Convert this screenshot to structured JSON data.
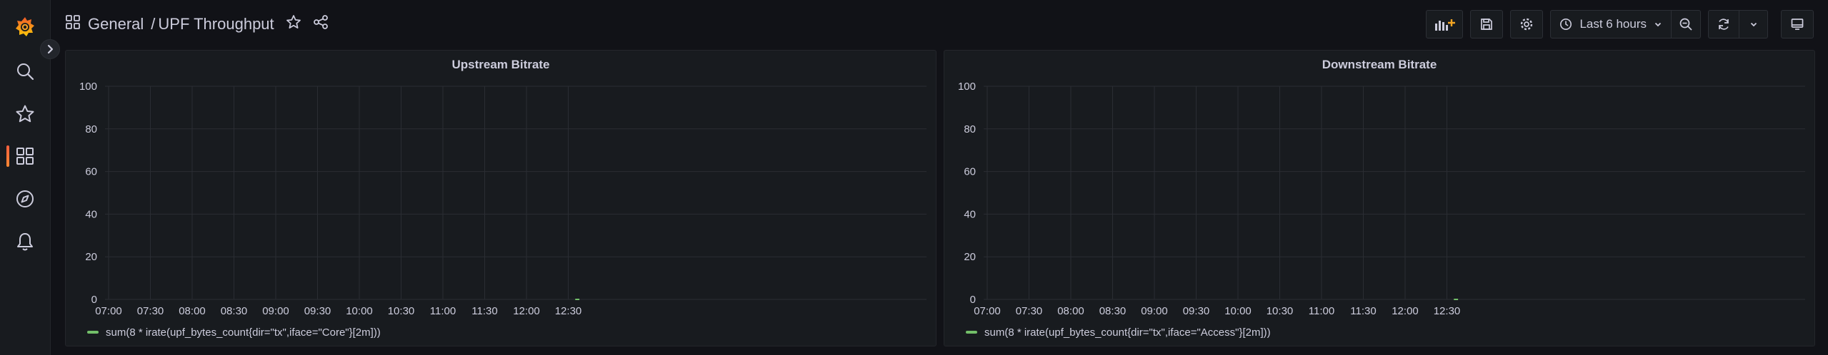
{
  "breadcrumb": {
    "folder": "General",
    "separator": "/",
    "dashboard": "UPF Throughput"
  },
  "toolbar": {
    "time_range": "Last 6 hours"
  },
  "icons": {
    "logo": "grafana-logo-icon",
    "search": "search-icon",
    "starred": "star-icon",
    "dashboards": "dashboards-grid-icon",
    "explore": "compass-icon",
    "alerting": "bell-icon"
  },
  "colors": {
    "accent": "#f55f3e",
    "series": "#73bf69",
    "background": "#111217",
    "panel": "#181b1f"
  },
  "panels": [
    {
      "title": "Upstream Bitrate",
      "legend": "sum(8 * irate(upf_bytes_count{dir=\"tx\",iface=\"Core\"}[2m]))"
    },
    {
      "title": "Downstream Bitrate",
      "legend": "sum(8 * irate(upf_bytes_count{dir=\"tx\",iface=\"Access\"}[2m]))"
    }
  ],
  "chart_data": [
    {
      "type": "line",
      "title": "Upstream Bitrate",
      "yticks": [
        "0",
        "20",
        "40",
        "60",
        "80",
        "100"
      ],
      "ylim": [
        0,
        100
      ],
      "xticks": [
        "07:00",
        "07:30",
        "08:00",
        "08:30",
        "09:00",
        "09:30",
        "10:00",
        "10:30",
        "11:00",
        "11:30",
        "12:00",
        "12:30"
      ],
      "grid": true,
      "legend_position": "bottom-left",
      "series": [
        {
          "name": "sum(8 * irate(upf_bytes_count{dir=\"tx\",iface=\"Core\"}[2m]))",
          "x": [
            "12:35",
            "12:38"
          ],
          "y": [
            0,
            0
          ]
        }
      ]
    },
    {
      "type": "line",
      "title": "Downstream Bitrate",
      "yticks": [
        "0",
        "20",
        "40",
        "60",
        "80",
        "100"
      ],
      "ylim": [
        0,
        100
      ],
      "xticks": [
        "07:00",
        "07:30",
        "08:00",
        "08:30",
        "09:00",
        "09:30",
        "10:00",
        "10:30",
        "11:00",
        "11:30",
        "12:00",
        "12:30"
      ],
      "grid": true,
      "legend_position": "bottom-left",
      "series": [
        {
          "name": "sum(8 * irate(upf_bytes_count{dir=\"tx\",iface=\"Access\"}[2m]))",
          "x": [
            "12:35",
            "12:38"
          ],
          "y": [
            0,
            0
          ]
        }
      ]
    }
  ]
}
